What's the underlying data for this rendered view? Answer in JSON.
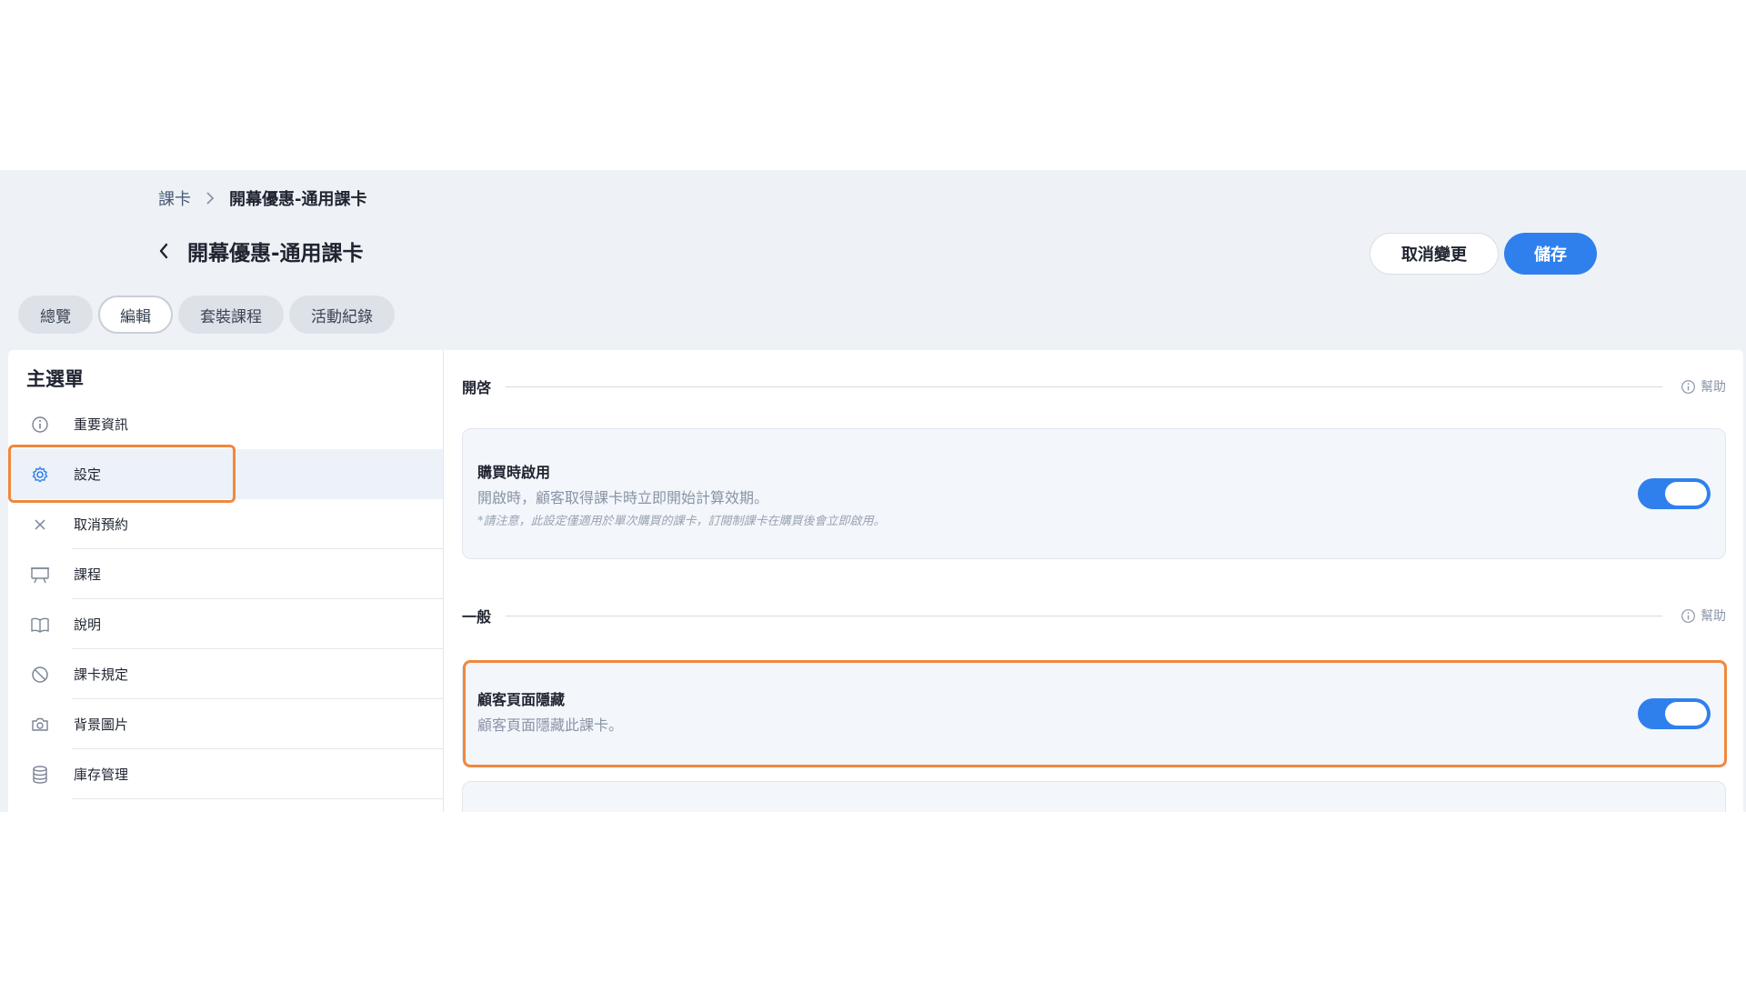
{
  "breadcrumb": {
    "parent": "課卡",
    "current": "開幕優惠-通用課卡"
  },
  "header": {
    "title": "開幕優惠-通用課卡",
    "cancel_label": "取消變更",
    "save_label": "儲存"
  },
  "tabs": [
    {
      "label": "總覽",
      "active": false
    },
    {
      "label": "編輯",
      "active": true
    },
    {
      "label": "套裝課程",
      "active": false
    },
    {
      "label": "活動紀錄",
      "active": false
    }
  ],
  "sidebar": {
    "title": "主選單",
    "items": [
      {
        "label": "重要資訊",
        "icon": "info-icon"
      },
      {
        "label": "設定",
        "icon": "gear-icon",
        "active": true
      },
      {
        "label": "取消預約",
        "icon": "close-icon"
      },
      {
        "label": "課程",
        "icon": "presentation-icon"
      },
      {
        "label": "說明",
        "icon": "book-icon"
      },
      {
        "label": "課卡規定",
        "icon": "ban-icon"
      },
      {
        "label": "背景圖片",
        "icon": "camera-icon"
      },
      {
        "label": "庫存管理",
        "icon": "database-icon"
      }
    ]
  },
  "main": {
    "sections": [
      {
        "title": "開啓",
        "help_label": "幫助",
        "card": {
          "title": "購買時啟用",
          "description": "開啟時，顧客取得課卡時立即開始計算效期。",
          "note": "*請注意，此設定僅適用於單次購買的課卡，訂閱制課卡在購買後會立即啟用。",
          "toggle_on": true
        }
      },
      {
        "title": "一般",
        "help_label": "幫助",
        "card": {
          "title": "顧客頁面隱藏",
          "description": "顧客頁面隱藏此課卡。",
          "toggle_on": true
        }
      }
    ]
  },
  "colors": {
    "accent": "#2f80ed",
    "highlight": "#f0883e",
    "background": "#eef2f6"
  }
}
